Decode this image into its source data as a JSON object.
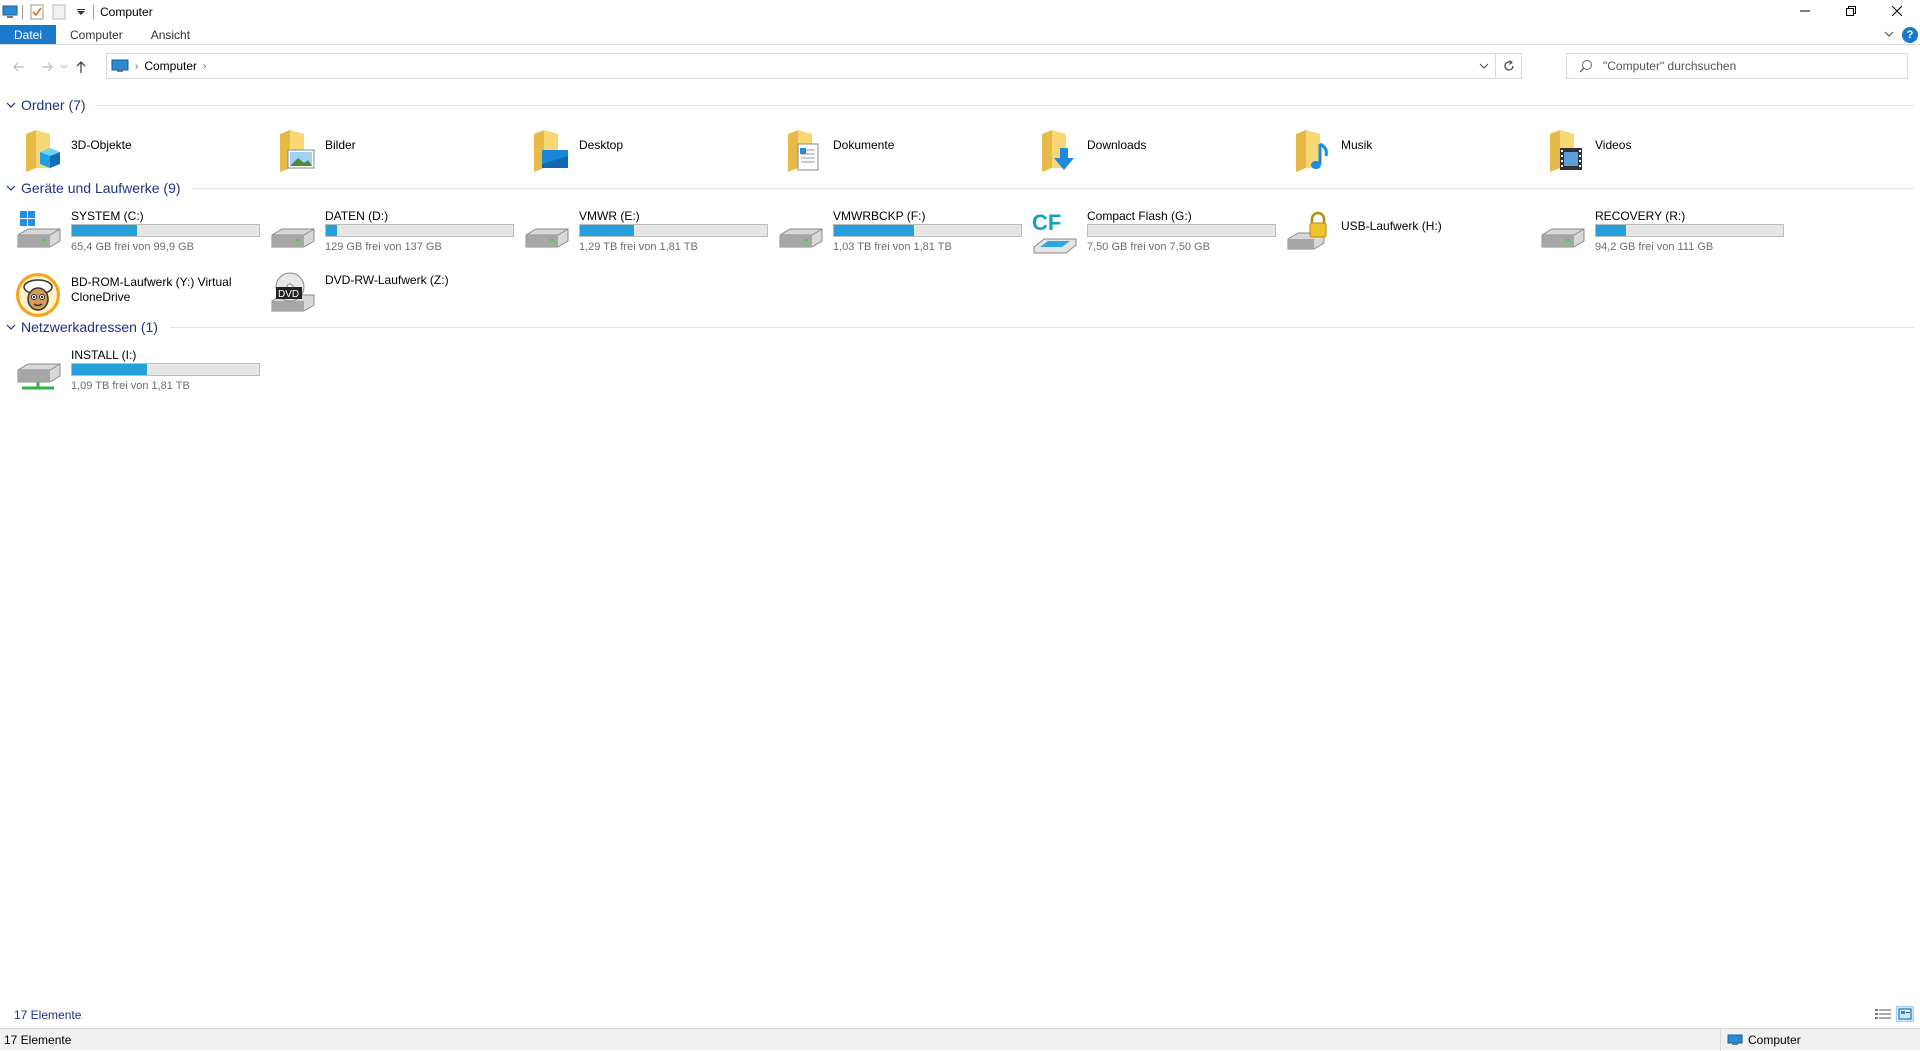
{
  "window": {
    "title": "Computer"
  },
  "ribbon": {
    "tabs": [
      "Datei",
      "Computer",
      "Ansicht"
    ]
  },
  "nav": {
    "breadcrumb": "Computer"
  },
  "search": {
    "placeholder": "\"Computer\" durchsuchen"
  },
  "groups": {
    "folders": {
      "title": "Ordner (7)",
      "items": [
        {
          "name": "3D-Objekte",
          "icon": "folder-3d-objects-icon"
        },
        {
          "name": "Bilder",
          "icon": "folder-pictures-icon"
        },
        {
          "name": "Desktop",
          "icon": "folder-desktop-icon"
        },
        {
          "name": "Dokumente",
          "icon": "folder-documents-icon"
        },
        {
          "name": "Downloads",
          "icon": "folder-downloads-icon"
        },
        {
          "name": "Musik",
          "icon": "folder-music-icon"
        },
        {
          "name": "Videos",
          "icon": "folder-videos-icon"
        }
      ]
    },
    "devices": {
      "title": "Geräte und Laufwerke (9)",
      "items": [
        {
          "name": "SYSTEM (C:)",
          "free": "65,4 GB frei von 99,9 GB",
          "used_fraction": 0.35,
          "icon": "windows-drive-icon"
        },
        {
          "name": "DATEN (D:)",
          "free": "129 GB frei von 137 GB",
          "used_fraction": 0.06,
          "icon": "hard-drive-icon"
        },
        {
          "name": "VMWR (E:)",
          "free": "1,29 TB frei von 1,81 TB",
          "used_fraction": 0.29,
          "icon": "hard-drive-icon"
        },
        {
          "name": "VMWRBCKP (F:)",
          "free": "1,03 TB frei von 1,81 TB",
          "used_fraction": 0.43,
          "icon": "hard-drive-icon"
        },
        {
          "name": "Compact Flash (G:)",
          "free": "7,50 GB frei von 7,50 GB",
          "used_fraction": 0.0,
          "icon": "compact-flash-icon"
        },
        {
          "name": "USB-Laufwerk (H:)",
          "icon": "locked-drive-icon"
        },
        {
          "name": "RECOVERY (R:)",
          "free": "94,2 GB frei von 111 GB",
          "used_fraction": 0.16,
          "icon": "hard-drive-icon"
        },
        {
          "name": "BD-ROM-Laufwerk (Y:) Virtual",
          "name2": "CloneDrive",
          "icon": "clonedrive-sheep-icon"
        },
        {
          "name": "DVD-RW-Laufwerk (Z:)",
          "icon": "dvd-drive-icon"
        }
      ]
    },
    "network": {
      "title": "Netzwerkadressen (1)",
      "items": [
        {
          "name": "INSTALL (I:)",
          "free": "1,09 TB frei von 1,81 TB",
          "used_fraction": 0.4,
          "icon": "network-drive-icon"
        }
      ]
    }
  },
  "status": {
    "count": "17 Elemente",
    "location": "Computer"
  }
}
